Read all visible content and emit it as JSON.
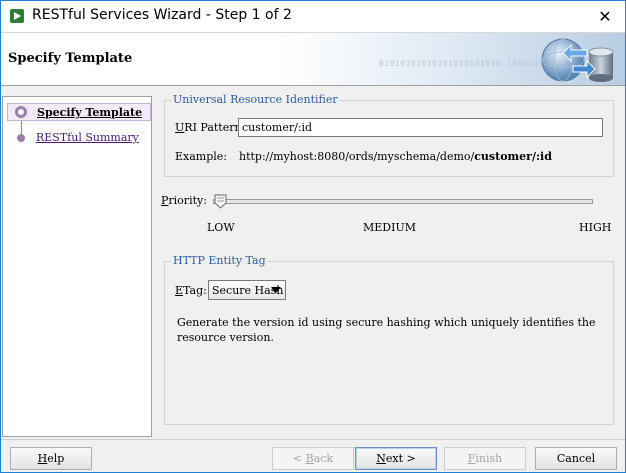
{
  "window": {
    "title": "RESTful Services Wizard - Step 1 of 2",
    "close_glyph": "✕"
  },
  "header": {
    "title": "Specify Template",
    "binary_decoration": "01010101010101010101010 1010101"
  },
  "nav": {
    "items": [
      {
        "label": "Specify Template",
        "active": true
      },
      {
        "label": "RESTful Summary",
        "active": false
      }
    ]
  },
  "uri": {
    "group_title": "Universal Resource Identifier",
    "pattern_label_accel": "U",
    "pattern_label_rest": "RI Pattern:",
    "pattern_value": "customer/:id",
    "example_label": "Example:",
    "example_prefix": "http://myhost:8080/ords/myschema/demo/",
    "example_bold": "customer/:id"
  },
  "priority": {
    "label_accel": "P",
    "label_rest": "riority:",
    "level": 0,
    "ticks": [
      "LOW",
      "MEDIUM",
      "HIGH"
    ]
  },
  "etag": {
    "group_title": "HTTP Entity Tag",
    "label_accel": "E",
    "label_rest": "Tag:",
    "selected": "Secure Hash",
    "description": "Generate the version id using secure hashing which uniquely identifies the resource version."
  },
  "buttons": {
    "help_accel": "H",
    "help_rest": "elp",
    "back_pre": "< ",
    "back_accel": "B",
    "back_rest": "ack",
    "next_accel": "N",
    "next_rest": "ext >",
    "finish_accel": "F",
    "finish_rest": "inish",
    "cancel": "Cancel"
  },
  "colors": {
    "window_border": "#1c7fd1",
    "group_title": "#2f5d9a",
    "nav_accent": "#9b7fb0"
  }
}
